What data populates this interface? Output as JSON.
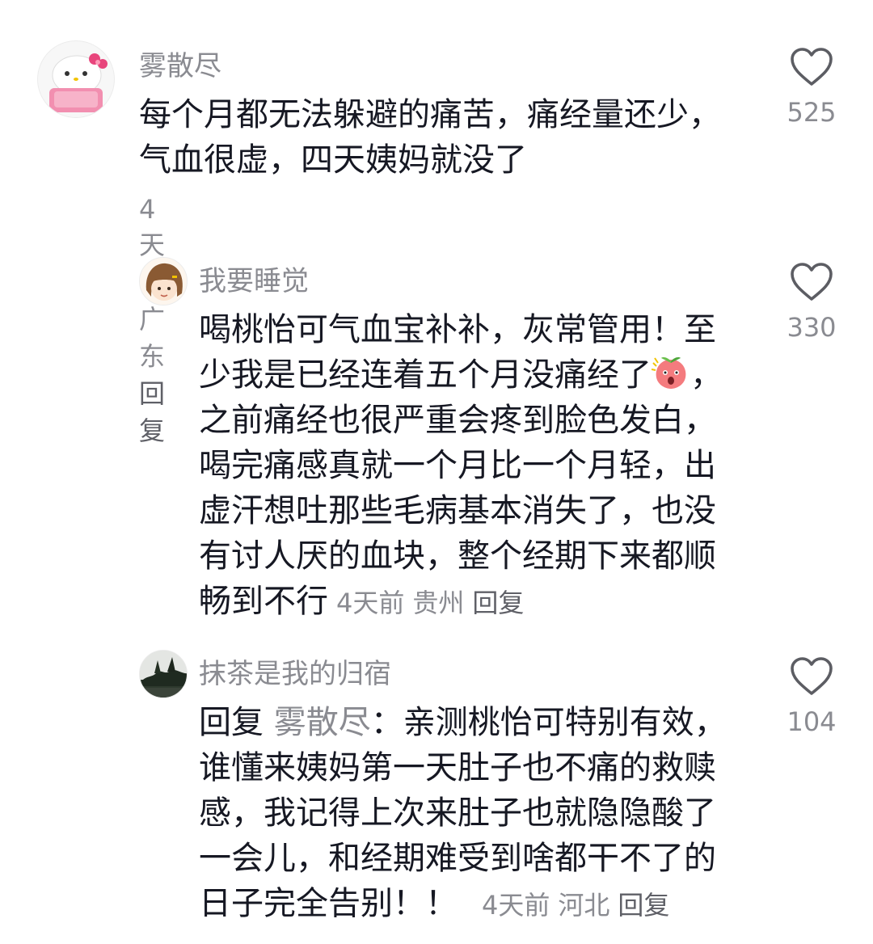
{
  "comments": [
    {
      "username": "雾散尽",
      "text_lines": [
        "每个月都无法躲避的痛苦，痛经量还少，",
        "气血很虚，四天姨妈就没了"
      ],
      "time": "4天前",
      "location": "广东",
      "reply": "回复",
      "likes": "525"
    },
    {
      "username": "我要睡觉",
      "text_lines": [
        "喝桃怡可气血宝补补，灰常管用！至",
        "少我是已经连着五个月没痛经了",
        "，",
        "之前痛经也很严重会疼到脸色发白，",
        "喝完痛感真就一个月比一个月轻，出",
        "虚汗想吐那些毛病基本消失了，也没",
        "有讨人厌的血块，整个经期下来都顺",
        "畅到不行"
      ],
      "time": "4天前",
      "location": "贵州",
      "reply": "回复",
      "likes": "330"
    },
    {
      "username": "抹茶是我的归宿",
      "reply_prefix": "回复",
      "reply_to": "雾散尽",
      "text_lines": [
        "：亲测桃怡可特别有效，",
        "谁懂来姨妈第一天肚子也不痛的救赎",
        "感，我记得上次来肚子也就隐隐酸了",
        "一会儿，和经期难受到啥都干不了的",
        "日子完全告别！！"
      ],
      "time": "4天前",
      "location": "河北",
      "reply": "回复",
      "likes": "104"
    }
  ]
}
